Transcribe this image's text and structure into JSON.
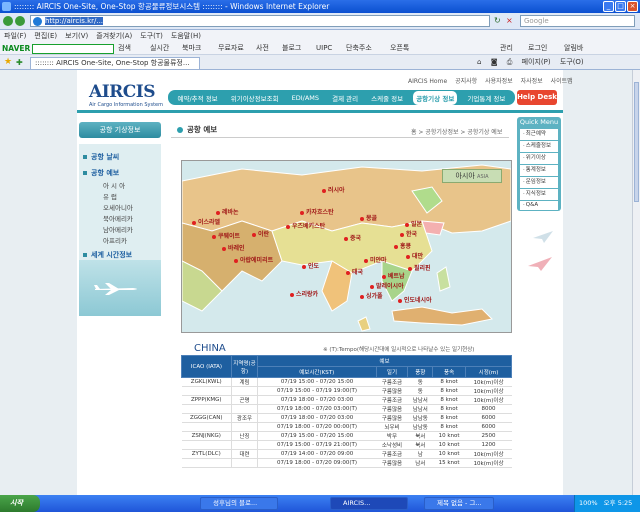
{
  "window": {
    "title": ":::::::: AIRCIS One-Site, One-Stop 항공물류정보시스템 :::::::: - Windows Internet Explorer",
    "address": "http://aircis.kr/...",
    "search_placeholder": "Google"
  },
  "menu": [
    "파일(F)",
    "편집(E)",
    "보기(V)",
    "즐겨찾기(A)",
    "도구(T)",
    "도움말(H)"
  ],
  "naver_toolbar": {
    "logo": "NAVER",
    "search_label": "검색",
    "items": [
      "실시간",
      "북마크",
      "무료자료",
      "사전",
      "블로그",
      "UIPC",
      "단축주소",
      "오픈톡"
    ],
    "right_items": [
      "관리",
      "로그인",
      "알림바"
    ]
  },
  "tab": {
    "label": ":::::::: AIRCIS One-Site, One-Stop 항공물류정...",
    "tools": [
      "페이지(P)",
      "도구(O)"
    ]
  },
  "site": {
    "top_links": [
      "AIRCIS Home",
      "공지사항",
      "사용자정보",
      "자사정보",
      "사이트맵"
    ],
    "logo": "AIRCIS",
    "logo_sub": "Air Cargo Information System",
    "nav": [
      "예약/추적 정보",
      "위기이상정보조회",
      "EDI/AMS",
      "결제 관리",
      "스케줄 정보",
      "공항기상 정보",
      "기업통계 정보"
    ],
    "nav_active": 5,
    "helpdesk": "Help Desk"
  },
  "left_menu": {
    "title": "공항 기상정보",
    "sections": [
      {
        "label": "공항 날씨"
      },
      {
        "label": "공항 예보"
      },
      {
        "label": "세계 시간정보"
      }
    ],
    "sub_items": [
      "아 시 아",
      "유 럽",
      "오세아니아",
      "북아메리카",
      "남아메리카",
      "아프리카"
    ]
  },
  "content": {
    "title": "공항 예보",
    "breadcrumb": "홈 > 공항기상정보 > 공항기상 예보",
    "map_badge": "아시아",
    "map_badge_sub": "ASIA",
    "cities": [
      "러시아",
      "카자흐스탄",
      "몽골",
      "일본",
      "레바논",
      "이스라엘",
      "우즈베키스탄",
      "중국",
      "한국",
      "쿠웨이트",
      "이란",
      "바레인",
      "아랍에미리트",
      "대만",
      "인도",
      "홍콩",
      "미얀마",
      "필리핀",
      "태국",
      "스리랑카",
      "말레이시아",
      "싱가폴",
      "인도네시아",
      "베트남"
    ]
  },
  "quick_menu": {
    "title": "Quick Menu",
    "items": [
      "최근예약",
      "스케줄정보",
      "위기이상",
      "통계정보",
      "운임정보",
      "지식정보",
      "Q&A"
    ]
  },
  "forecast": {
    "region": "CHINA",
    "note": "※ (T):Tempo(해당시간대에 일시적으로 나타날수 있는 일기현상)",
    "headers": {
      "icao": "ICAO (IATA)",
      "name": "지역명(공항)",
      "group": "예보",
      "time": "예보시간(KST)",
      "weather": "일기",
      "wind_dir": "풍향",
      "wind_speed": "풍속",
      "visibility": "시정(m)"
    },
    "rows": [
      {
        "icao": "ZGKL(KWL)",
        "name": "계림",
        "time": "07/19 15:00 - 07/20 15:00",
        "weather": "구름조금",
        "dir": "동",
        "speed": "8 knot",
        "vis": "10k(m)이상"
      },
      {
        "icao": "",
        "name": "",
        "time": "07/19 15:00 - 07/19 19:00(T)",
        "weather": "구름많음",
        "dir": "동",
        "speed": "8 knot",
        "vis": "10k(m)이상"
      },
      {
        "icao": "ZPPP(KMG)",
        "name": "곤명",
        "time": "07/19 18:00 - 07/20 03:00",
        "weather": "구름조금",
        "dir": "남남서",
        "speed": "8 knot",
        "vis": "10k(m)이상"
      },
      {
        "icao": "",
        "name": "",
        "time": "07/19 18:00 - 07/20 03:00(T)",
        "weather": "구름많음",
        "dir": "남남서",
        "speed": "8 knot",
        "vis": "8000"
      },
      {
        "icao": "ZGGG(CAN)",
        "name": "광조우",
        "time": "07/19 18:00 - 07/20 03:00",
        "weather": "구름많음",
        "dir": "남남동",
        "speed": "8 knot",
        "vis": "6000"
      },
      {
        "icao": "",
        "name": "",
        "time": "07/19 18:00 - 07/20 00:00(T)",
        "weather": "뇌우비",
        "dir": "남남동",
        "speed": "8 knot",
        "vis": "6000"
      },
      {
        "icao": "ZSNJ(NKG)",
        "name": "난징",
        "time": "07/19 15:00 - 07/20 15:00",
        "weather": "박무",
        "dir": "북서",
        "speed": "10 knot",
        "vis": "2500"
      },
      {
        "icao": "",
        "name": "",
        "time": "07/19 15:00 - 07/19 21:00(T)",
        "weather": "소낙성비",
        "dir": "북서",
        "speed": "10 knot",
        "vis": "1200"
      },
      {
        "icao": "ZYTL(DLC)",
        "name": "대련",
        "time": "07/19 14:00 - 07/20 09:00",
        "weather": "구름조금",
        "dir": "남",
        "speed": "10 knot",
        "vis": "10k(m)이상"
      },
      {
        "icao": "",
        "name": "",
        "time": "07/19 18:00 - 07/20 09:00(T)",
        "weather": "구름많음",
        "dir": "남서",
        "speed": "15 knot",
        "vis": "10k(m)이상"
      }
    ]
  },
  "taskbar": {
    "start": "시작",
    "tasks": [
      "성후님의 블로...",
      "AIRCIS...",
      "제목 없음 - 그..."
    ],
    "status_text": "인터넷",
    "zoom": "100%",
    "clock": "오후 5:25"
  },
  "colors": {
    "teal": "#2d9fae",
    "navy": "#1e5fa0",
    "helpdesk": "#e8462f"
  }
}
